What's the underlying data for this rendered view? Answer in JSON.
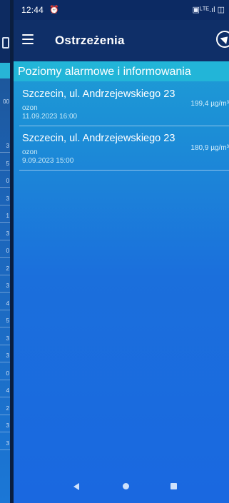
{
  "status_bar": {
    "time": "12:44",
    "alarm_icon": "alarm-clock-icon",
    "system_icons": "▣ᴸᵀᴱ.ıl ◫"
  },
  "app_bar": {
    "menu_icon": "hamburger-menu-icon",
    "title": "Ostrzeżenia",
    "action_icon": "navigation-arrow-icon"
  },
  "section": {
    "title": "Poziomy alarmowe i informowania"
  },
  "alerts": [
    {
      "location": "Szczecin, ul. Andrzejewskiego 23",
      "pollutant": "ozon",
      "datetime": "11.09.2023 16:00",
      "value": "199,4 µg/m³"
    },
    {
      "location": "Szczecin, ul. Andrzejewskiego 23",
      "pollutant": "ozon",
      "datetime": "9.09.2023 15:00",
      "value": "180,9 µg/m³"
    }
  ],
  "left_panel_values": [
    "00",
    "3",
    "5",
    "0",
    "3",
    "1",
    "3",
    "0",
    "2",
    "3",
    "4",
    "5",
    "3",
    "3",
    "0",
    "4",
    "2",
    "3",
    "3"
  ],
  "nav_bar": {
    "back_icon": "back-triangle-icon",
    "home_icon": "home-circle-icon",
    "recent_icon": "recent-apps-square-icon"
  },
  "colors": {
    "app_bar": "#0f2f68",
    "section_header": "#22b5d8",
    "background_top": "#20a8d4",
    "background_bottom": "#1a68e0"
  }
}
